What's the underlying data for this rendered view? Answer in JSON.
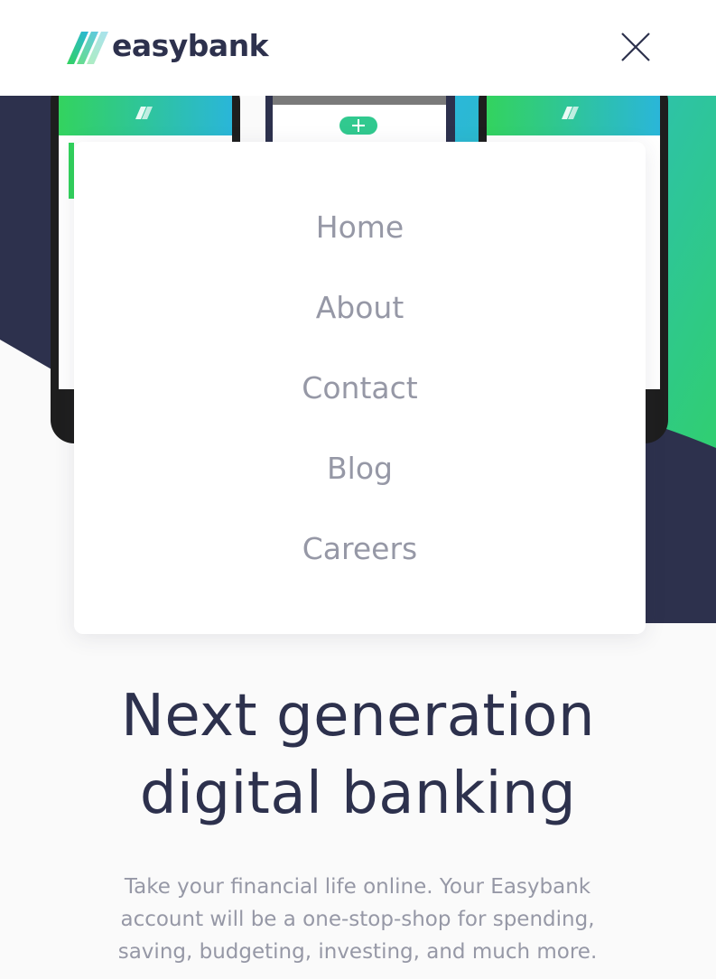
{
  "brand": {
    "name": "easybank",
    "colors": {
      "dark_blue": "#2d314d",
      "lime_green": "#31d35c",
      "bright_cyan": "#2bb7da",
      "grayish_blue": "#9698a6",
      "light_bg": "#fafafa"
    }
  },
  "header": {
    "logo_icon": "easybank-logo-icon",
    "close_icon": "close-icon"
  },
  "menu": {
    "items": [
      {
        "label": "Home"
      },
      {
        "label": "About"
      },
      {
        "label": "Contact"
      },
      {
        "label": "Blog"
      },
      {
        "label": "Careers"
      }
    ]
  },
  "intro": {
    "title_line1": "Next generation",
    "title_line2": "digital banking",
    "description_line1": "Take your financial life online. Your Easybank",
    "description_line2": "account will be a one-stop-shop for spending,",
    "description_line3": "saving, budgeting, investing, and much more."
  }
}
